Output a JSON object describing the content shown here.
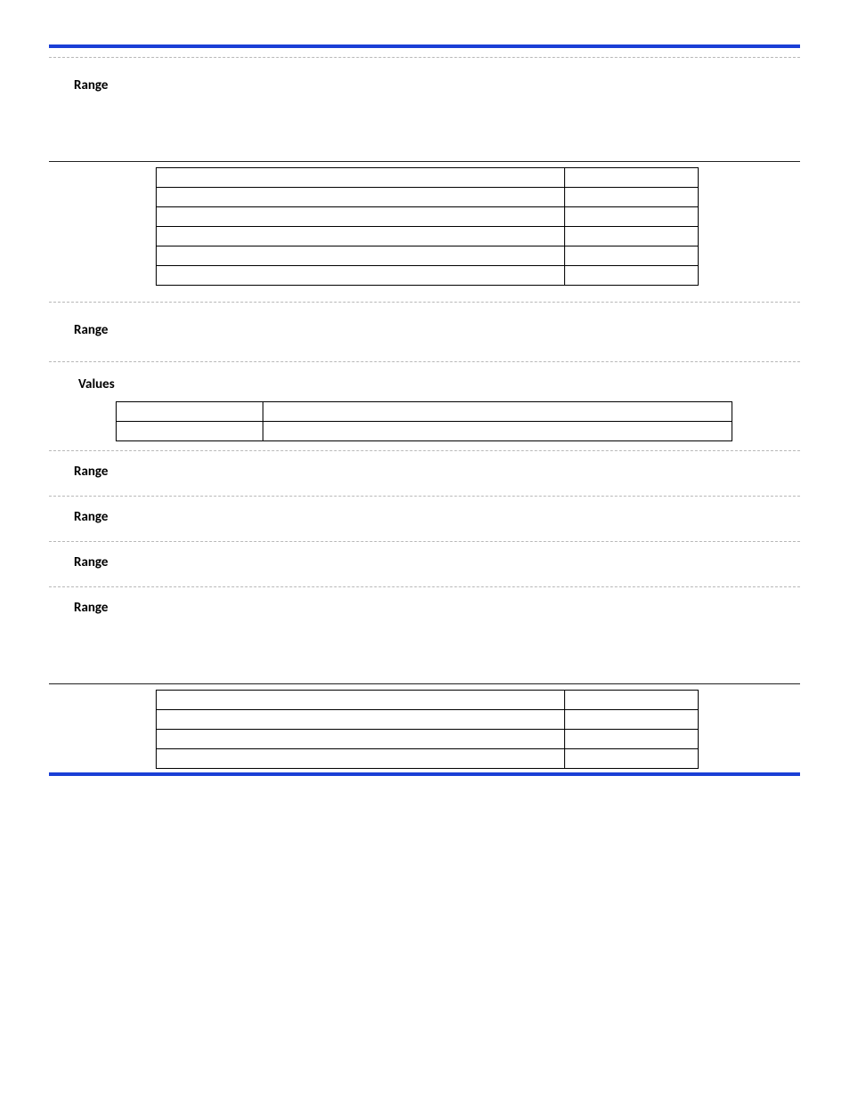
{
  "labels": {
    "range": "Range",
    "values": "Values"
  },
  "table1": {
    "rows": [
      {
        "a": "",
        "b": ""
      },
      {
        "a": "",
        "b": ""
      },
      {
        "a": "",
        "b": ""
      },
      {
        "a": "",
        "b": ""
      },
      {
        "a": "",
        "b": ""
      },
      {
        "a": "",
        "b": ""
      }
    ]
  },
  "values_table": {
    "rows": [
      {
        "a": "",
        "b": ""
      },
      {
        "a": "",
        "b": ""
      }
    ]
  },
  "table2": {
    "rows": [
      {
        "a": "",
        "b": ""
      },
      {
        "a": "",
        "b": ""
      },
      {
        "a": "",
        "b": ""
      },
      {
        "a": "",
        "b": ""
      }
    ]
  }
}
